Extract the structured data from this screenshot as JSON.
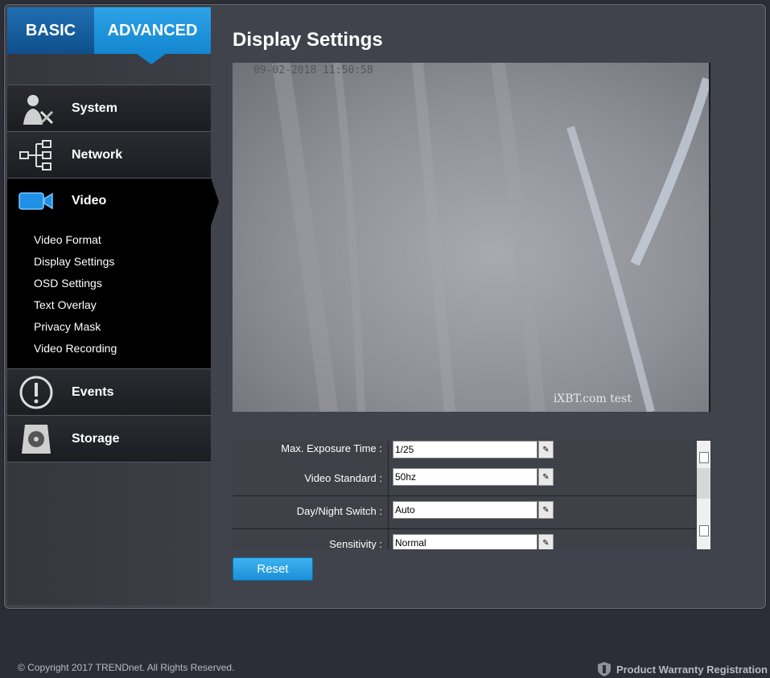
{
  "tabs": {
    "basic": "BASIC",
    "advanced": "ADVANCED"
  },
  "nav": {
    "system": "System",
    "network": "Network",
    "video": "Video",
    "events": "Events",
    "storage": "Storage"
  },
  "video_subitems": [
    "Video Format",
    "Display Settings",
    "OSD Settings",
    "Text Overlay",
    "Privacy Mask",
    "Video Recording"
  ],
  "page_title": "Display Settings",
  "preview": {
    "timestamp": "09-02-2018 11:50:58",
    "watermark": "iXBT.com test"
  },
  "settings": [
    {
      "label": "Max. Exposure Time :",
      "value": "1/25"
    },
    {
      "label": "Video Standard :",
      "value": "50hz"
    },
    {
      "label": "Day/Night Switch :",
      "value": "Auto"
    },
    {
      "label": "Sensitivity :",
      "value": "Normal"
    }
  ],
  "reset_label": "Reset",
  "footer": {
    "copyright": "© Copyright 2017 TRENDnet. All Rights Reserved.",
    "warranty": "Product Warranty Registration"
  },
  "colors": {
    "accent": "#1a8fd8",
    "basic_tab": "#0f4f8c",
    "sidebar": "#1c1d21"
  }
}
